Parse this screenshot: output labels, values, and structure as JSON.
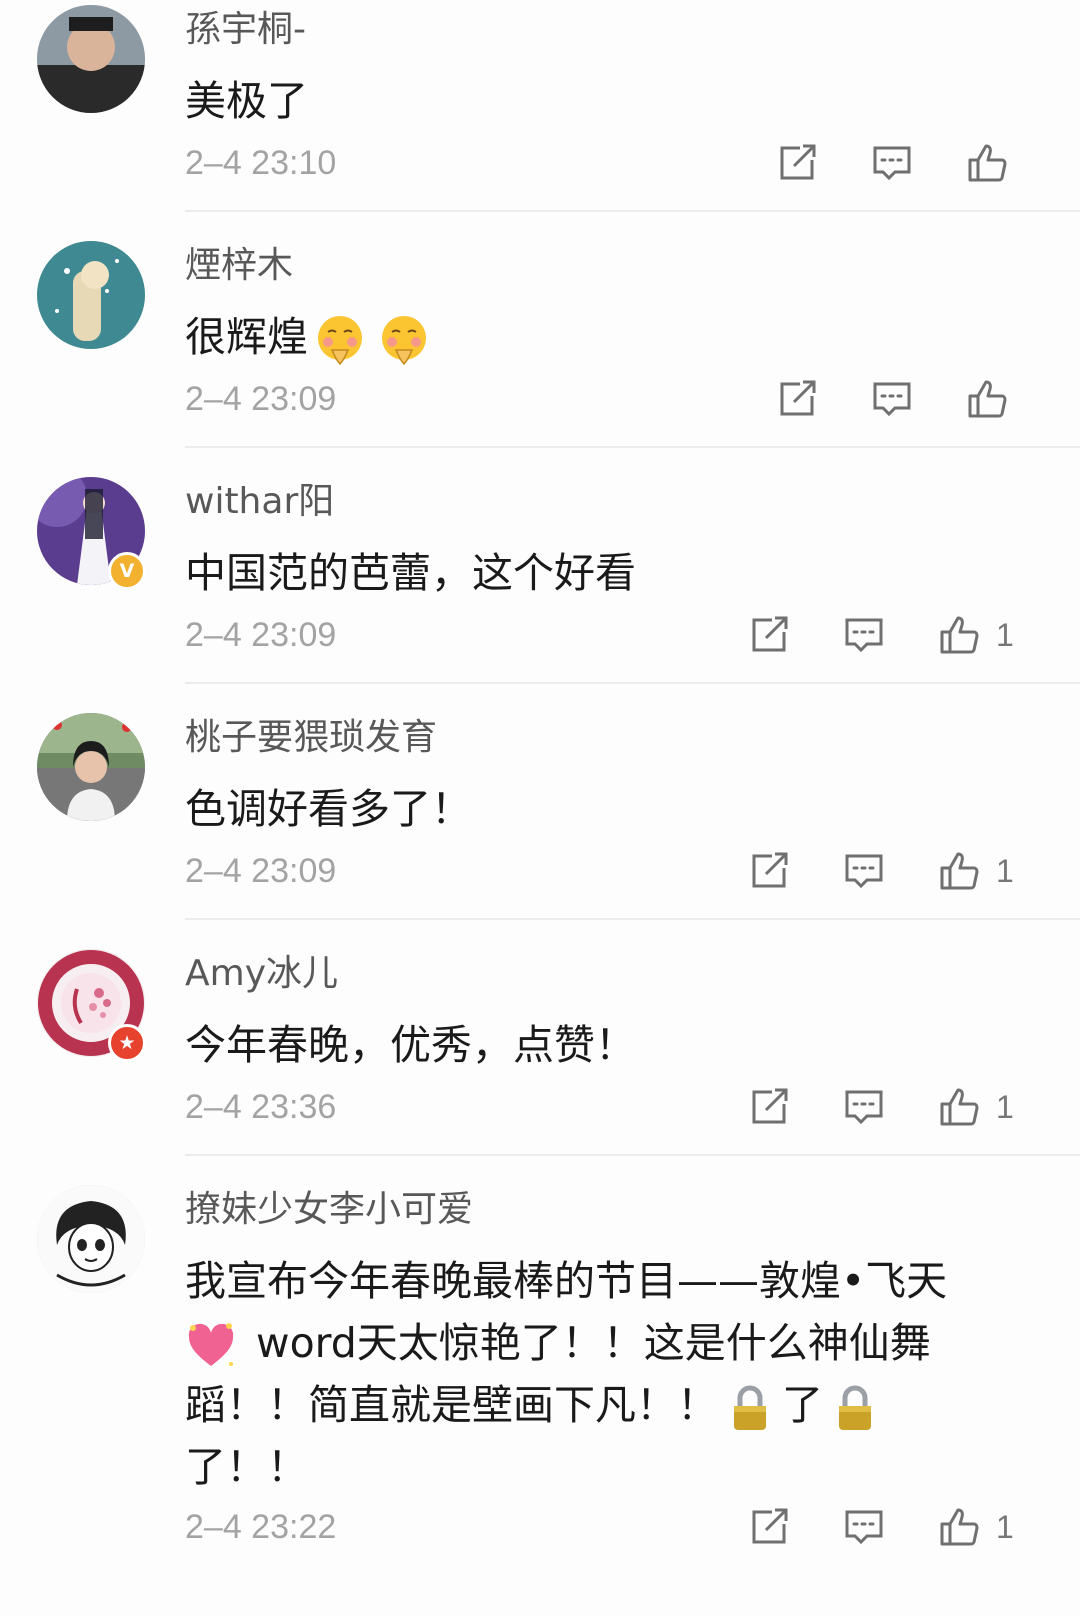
{
  "comments": [
    {
      "username": "孫宇桐-",
      "text": "美极了",
      "timestamp": "2–4 23:10",
      "like_count": "",
      "badge": "",
      "avatar_icon": "avatar-photo"
    },
    {
      "username": "煙梓木",
      "text": "很辉煌",
      "timestamp": "2–4 23:09",
      "like_count": "",
      "badge": "",
      "avatar_icon": "avatar-photo",
      "emojis": [
        "shy-emoji",
        "shy-emoji"
      ]
    },
    {
      "username": "withar阳",
      "text": "中国范的芭蕾，这个好看",
      "timestamp": "2–4 23:09",
      "like_count": "1",
      "badge": "V",
      "avatar_icon": "avatar-photo"
    },
    {
      "username": "桃子要猥琐发育",
      "text": "色调好看多了！",
      "timestamp": "2–4 23:09",
      "like_count": "1",
      "badge": "",
      "avatar_icon": "avatar-photo"
    },
    {
      "username": "Amy冰儿",
      "text": "今年春晚，优秀，点赞！",
      "timestamp": "2–4 23:36",
      "like_count": "1",
      "badge": "★",
      "avatar_icon": "avatar-logo"
    },
    {
      "username": "撩妹少女李小可爱",
      "text_parts": {
        "p1": "我宣布今年春晚最棒的节目——敦煌•飞天",
        "p2": " word天太惊艳了！！这是什么神仙舞蹈！！简直就是壁画下凡！！",
        "p3": "了",
        "p4": "了！！"
      },
      "timestamp": "2–4 23:22",
      "like_count": "1",
      "badge": "",
      "avatar_icon": "avatar-manga",
      "emojis": [
        "sparkling-heart-emoji",
        "lock-emoji",
        "lock-emoji"
      ]
    }
  ],
  "icons": {
    "repost": "repost-icon",
    "comment": "comment-icon",
    "like": "thumbs-up-icon"
  },
  "colors": {
    "name": "#585858",
    "text": "#1a1a1a",
    "timestamp": "#a3a3a3",
    "icon": "#707070",
    "divider": "#ececec"
  }
}
